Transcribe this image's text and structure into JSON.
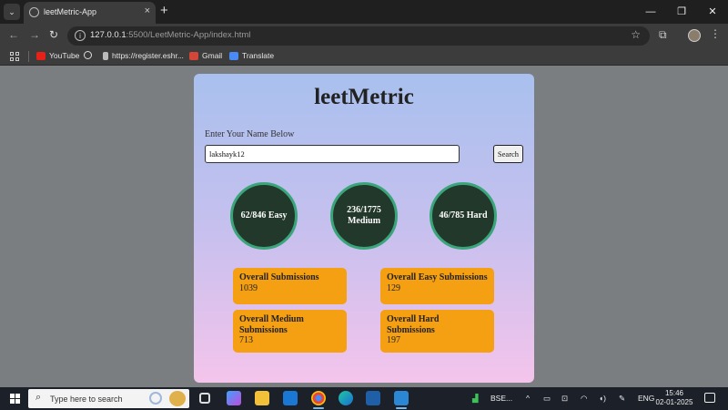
{
  "browser": {
    "tab_title": "leetMetric-App",
    "url_host": "127.0.0.1",
    "url_rest": ":5500/LeetMetric-App/index.html",
    "bookmarks": [
      "YouTube",
      "https://register.eshr...",
      "Gmail",
      "Translate"
    ]
  },
  "page": {
    "title": "leetMetric",
    "prompt_label": "Enter Your Name Below",
    "username_value": "lakshayk12",
    "search_label": "Search",
    "progress": {
      "easy": {
        "label": "62/846 Easy",
        "solved": 62,
        "total": 846
      },
      "medium": {
        "label": "236/1775 Medium",
        "solved": 236,
        "total": 1775
      },
      "hard": {
        "label": "46/785 Hard",
        "solved": 46,
        "total": 785
      }
    },
    "stats": [
      {
        "title": "Overall Submissions",
        "value": "1039"
      },
      {
        "title": "Overall Easy Submissions",
        "value": "129"
      },
      {
        "title": "Overall Medium Submissions",
        "value": "713"
      },
      {
        "title": "Overall Hard Submissions",
        "value": "197"
      }
    ]
  },
  "taskbar": {
    "search_placeholder": "Type here to search",
    "market_label": "BSE...",
    "language": "ENG",
    "time": "15:46",
    "date": "02-01-2025"
  },
  "colors": {
    "ring_fill": "#22382a",
    "ring_border": "#3aa57a",
    "stat_card": "#f59f12",
    "card_gradient_top": "#a9c0ee",
    "card_gradient_bottom": "#f4c4ec"
  }
}
